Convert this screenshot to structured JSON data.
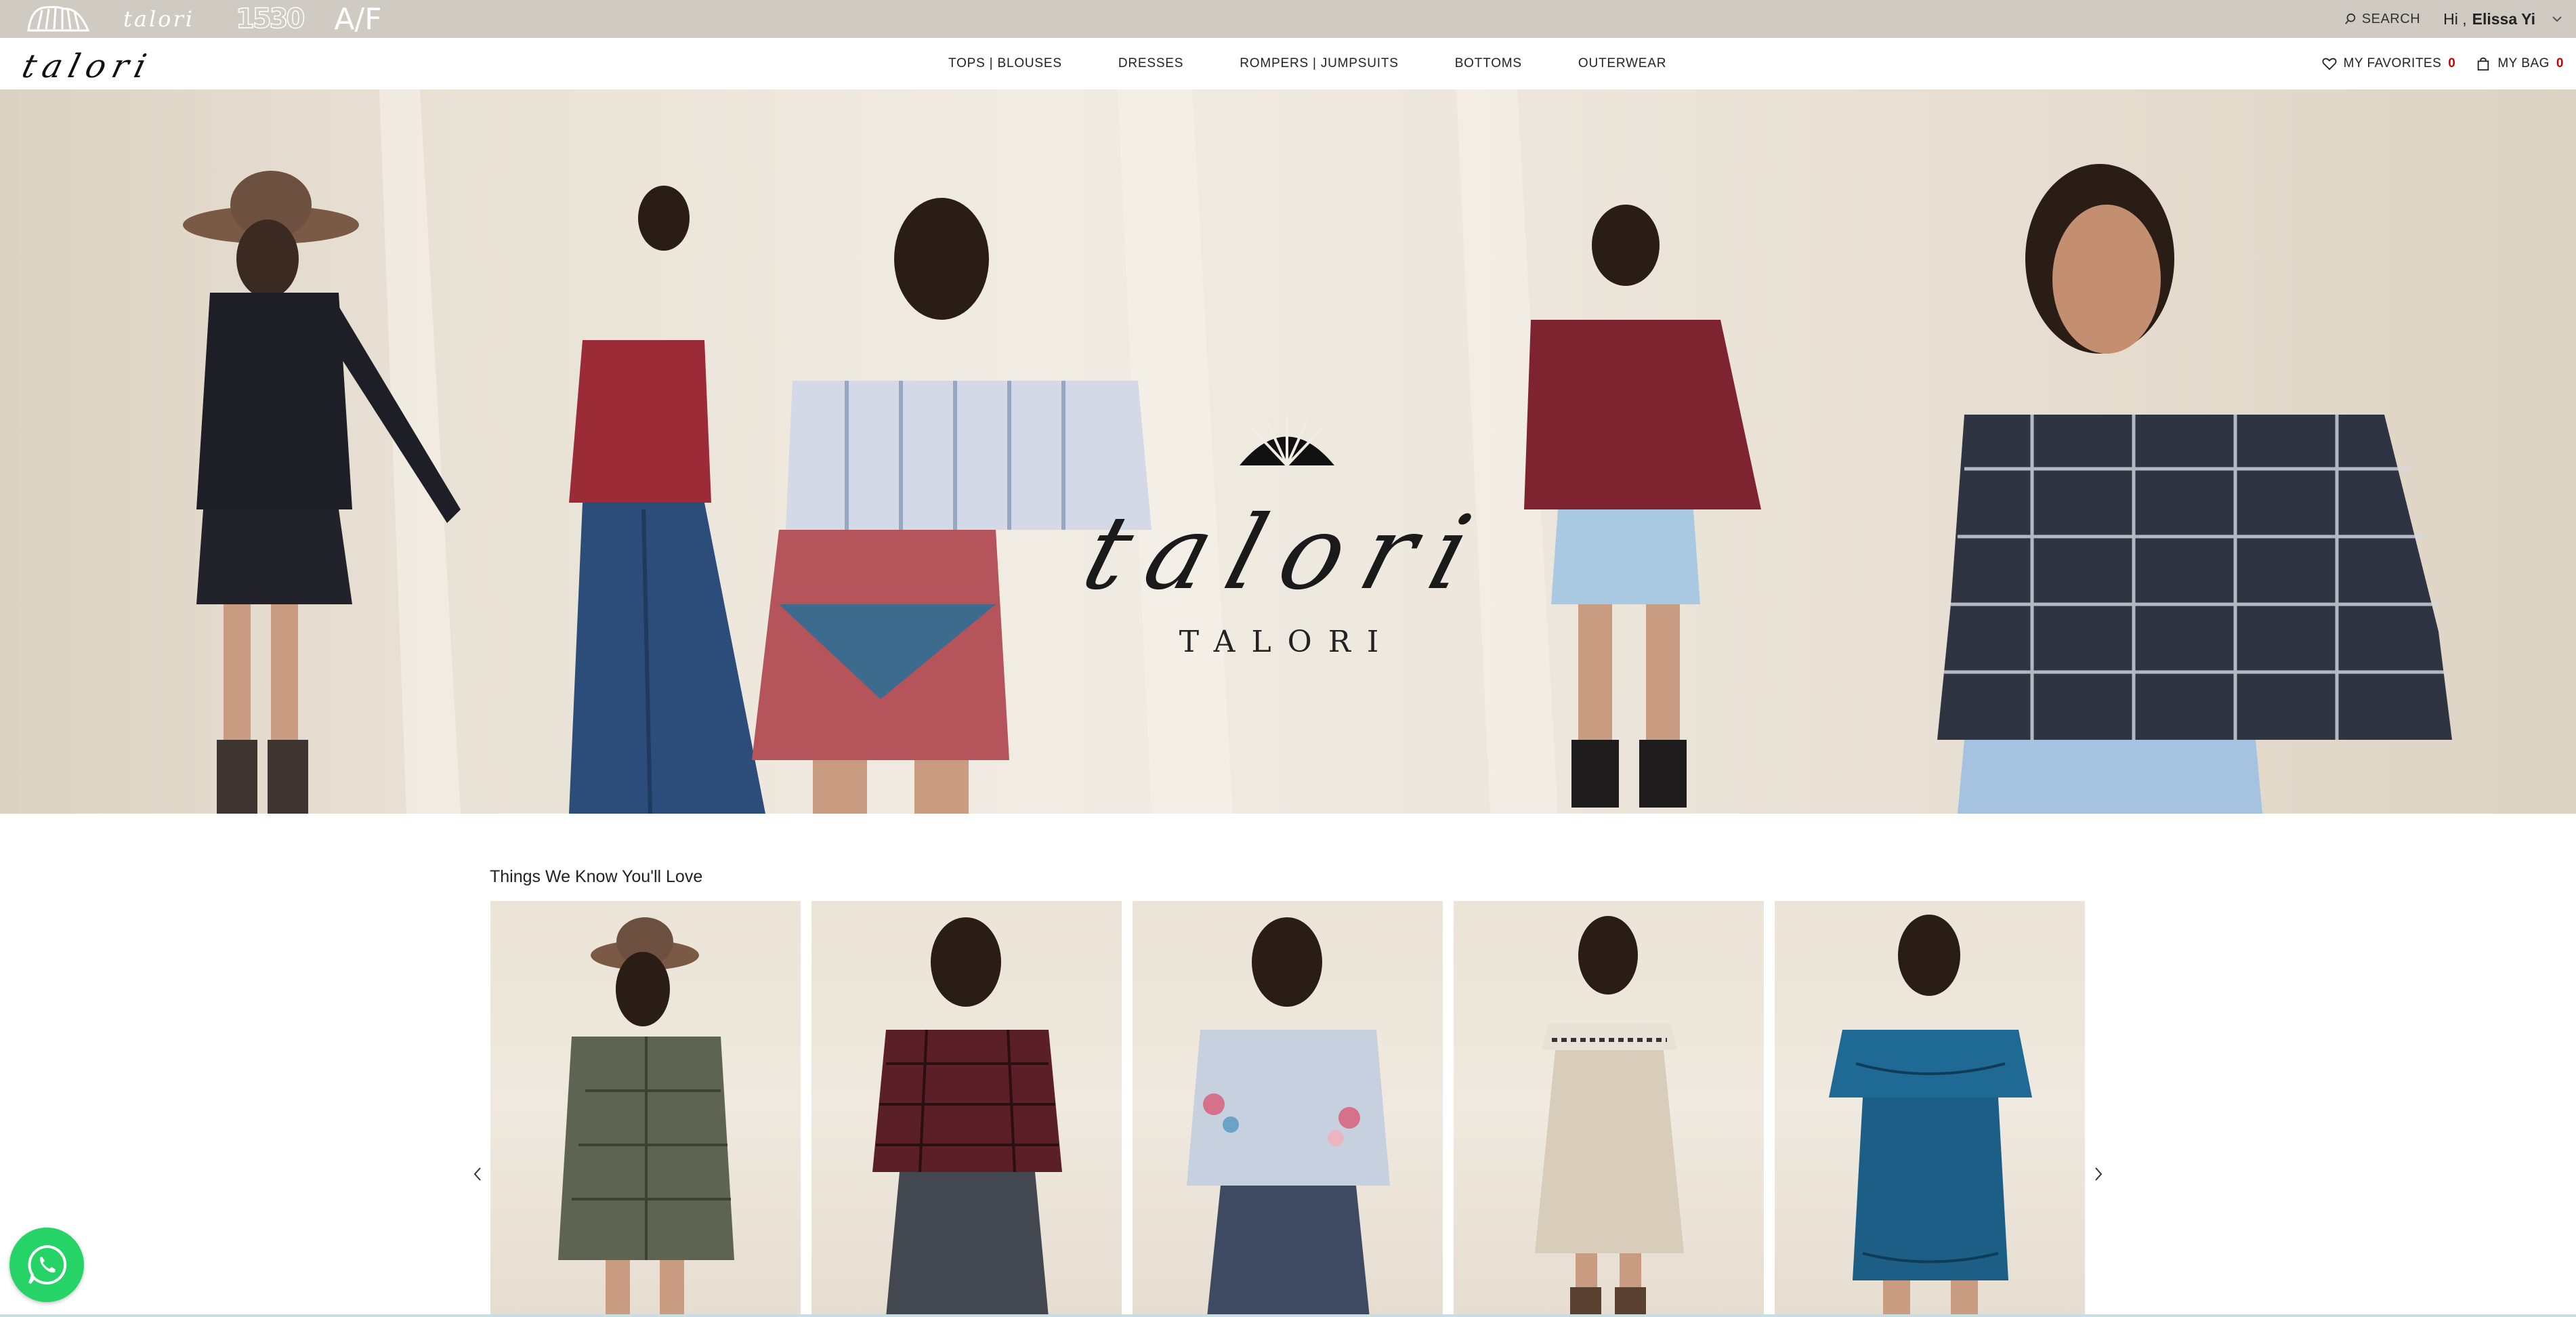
{
  "brandbar": {
    "logos": [
      "shell-logo",
      "talori-logo",
      "1530-logo",
      "af-logo"
    ],
    "logo_text": {
      "talori": "talori",
      "b1530": "1530",
      "af": "A/F"
    },
    "search_label": "SEARCH",
    "greeting": "Hi ,",
    "user_name": "Elissa Yi",
    "bg_color": "#cfcbc3"
  },
  "nav": {
    "logo_text": "talori",
    "links": [
      "TOPS | BLOUSES",
      "DRESSES",
      "ROMPERS | JUMPSUITS",
      "BOTTOMS",
      "OUTERWEAR"
    ],
    "favorites_label": "MY FAVORITES",
    "favorites_count": "0",
    "bag_label": "MY BAG",
    "bag_count": "0",
    "count_color": "#d10000"
  },
  "hero": {
    "script_logo": "talori",
    "wordmark": "TALORI",
    "image_description_icon": "hero-banner-image"
  },
  "recommendations": {
    "title": "Things We Know You'll Love",
    "products": [
      {
        "icon": "olive-plaid-dress-image"
      },
      {
        "icon": "burgundy-plaid-top-image"
      },
      {
        "icon": "embroidered-sweatshirt-image"
      },
      {
        "icon": "cream-off-shoulder-dress-image"
      },
      {
        "icon": "teal-embroidered-romper-image"
      }
    ]
  },
  "chat": {
    "icon": "whatsapp-icon",
    "color": "#25d366"
  }
}
